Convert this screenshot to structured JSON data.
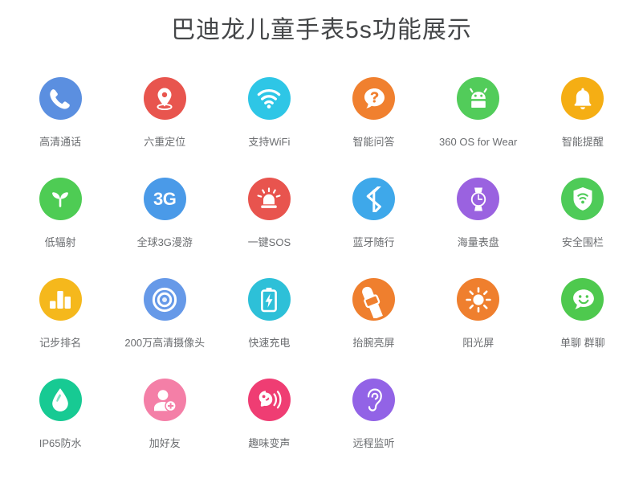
{
  "page": {
    "title": "巴迪龙儿童手表5s功能展示",
    "background_color": "#ffffff",
    "title_color": "#444648",
    "label_color": "#6b6d70"
  },
  "features": [
    [
      {
        "label": "高清通话",
        "icon": "phone-icon",
        "color": "#5b8fe0"
      },
      {
        "label": "六重定位",
        "icon": "location-pin-icon",
        "color": "#e8554e"
      },
      {
        "label": "支持WiFi",
        "icon": "wifi-icon",
        "color": "#2ec6e6"
      },
      {
        "label": "智能问答",
        "icon": "question-bubble-icon",
        "color": "#f0802f"
      },
      {
        "label": "360 OS for Wear",
        "icon": "android-robot-icon",
        "color": "#52cc5a"
      },
      {
        "label": "智能提醒",
        "icon": "bell-icon",
        "color": "#f5ae14"
      }
    ],
    [
      {
        "label": "低辐射",
        "icon": "sprout-icon",
        "color": "#4ecc54"
      },
      {
        "label": "全球3G漫游",
        "icon": "3g-text-icon",
        "color": "#4a9ae8",
        "glyph": "3G"
      },
      {
        "label": "一键SOS",
        "icon": "siren-alarm-icon",
        "color": "#e8544e"
      },
      {
        "label": "蓝牙随行",
        "icon": "bluetooth-icon",
        "color": "#3ea8ea"
      },
      {
        "label": "海量表盘",
        "icon": "wristwatch-icon",
        "color": "#9a62e0"
      },
      {
        "label": "安全围栏",
        "icon": "shield-wifi-icon",
        "color": "#4ecb58"
      }
    ],
    [
      {
        "label": "记步排名",
        "icon": "bar-chart-icon",
        "color": "#f5b81c"
      },
      {
        "label": "200万高清摄像头",
        "icon": "camera-lens-icon",
        "color": "#6699e8"
      },
      {
        "label": "快速充电",
        "icon": "battery-charging-icon",
        "color": "#2dc0d8"
      },
      {
        "label": "抬腕亮屏",
        "icon": "raise-wrist-icon",
        "color": "#ef7f2e"
      },
      {
        "label": "阳光屏",
        "icon": "sun-icon",
        "color": "#ef7f2e"
      },
      {
        "label": "单聊 群聊",
        "icon": "smiley-chat-icon",
        "color": "#4ec94e"
      }
    ],
    [
      {
        "label": "IP65防水",
        "icon": "water-drop-icon",
        "color": "#17ca93"
      },
      {
        "label": "加好友",
        "icon": "add-friend-icon",
        "color": "#f munge"
      },
      {
        "label": "趣味变声",
        "icon": "voice-changer-icon",
        "color": "#ef3d73"
      },
      {
        "label": "远程监听",
        "icon": "ear-listen-icon",
        "color": "#9263e6"
      }
    ]
  ],
  "colors": {
    "add_friend": "#f47fa7",
    "blue": "#5b8fe0",
    "red": "#e8554e",
    "cyan": "#2ec6e6",
    "orange": "#f0802f",
    "green": "#52cc5a",
    "amber": "#f5ae14",
    "purple": "#9a62e0",
    "teal": "#17ca93",
    "pink": "#ef3d73"
  }
}
